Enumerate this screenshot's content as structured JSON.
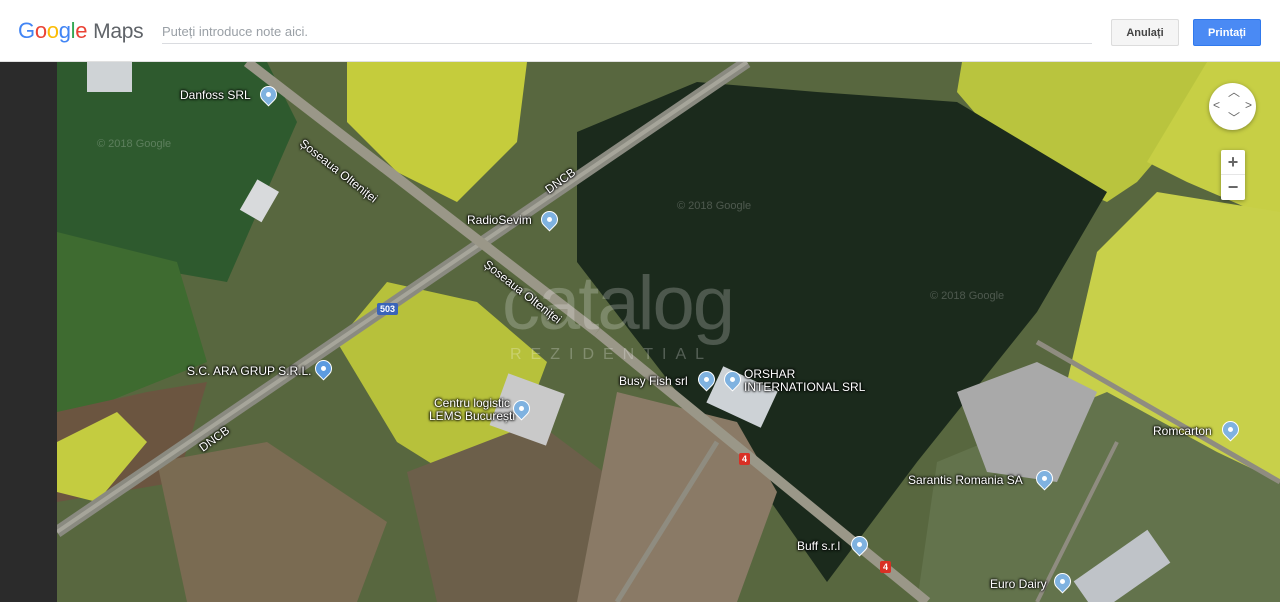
{
  "header": {
    "logo": {
      "g1": "G",
      "g2": "o",
      "g3": "o",
      "g4": "g",
      "g5": "l",
      "g6": "e",
      "maps": "Maps"
    },
    "notes_placeholder": "Puteți introduce note aici.",
    "cancel_label": "Anulați",
    "print_label": "Printați"
  },
  "map": {
    "controls": {
      "zoom_in": "+",
      "zoom_out": "−",
      "compass_icon": "compass-icon"
    },
    "places": [
      {
        "name": "Danfoss SRL"
      },
      {
        "name": "RadioSevim"
      },
      {
        "name": "S.C. ARA GRUP S.R.L."
      },
      {
        "name": "Centru logistic LEMS București"
      },
      {
        "name": "Busy Fish srl"
      },
      {
        "name": "ORSHAR INTERNATIONAL SRL"
      },
      {
        "name": "Romcarton"
      },
      {
        "name": "Sarantis Romania SA"
      },
      {
        "name": "Buff s.r.l"
      },
      {
        "name": "Euro Dairy"
      }
    ],
    "roads": {
      "soseaua_1": "Șoseaua Olteniței",
      "soseaua_2": "Șoseaua Olteniței",
      "dncb_1": "DNCB",
      "dncb_2": "DNCB",
      "shield_503": "503",
      "shield_4a": "4",
      "shield_4b": "4"
    },
    "watermark": {
      "main": "catalog",
      "sub": "REZIDENTIAL"
    },
    "copyright": [
      "© 2018 Google",
      "© 2018 Google",
      "© 2018 Google"
    ],
    "colors": {
      "shield_blue": "#3a64b8",
      "shield_red": "#d93025",
      "pin": "#7fb2e0"
    }
  }
}
